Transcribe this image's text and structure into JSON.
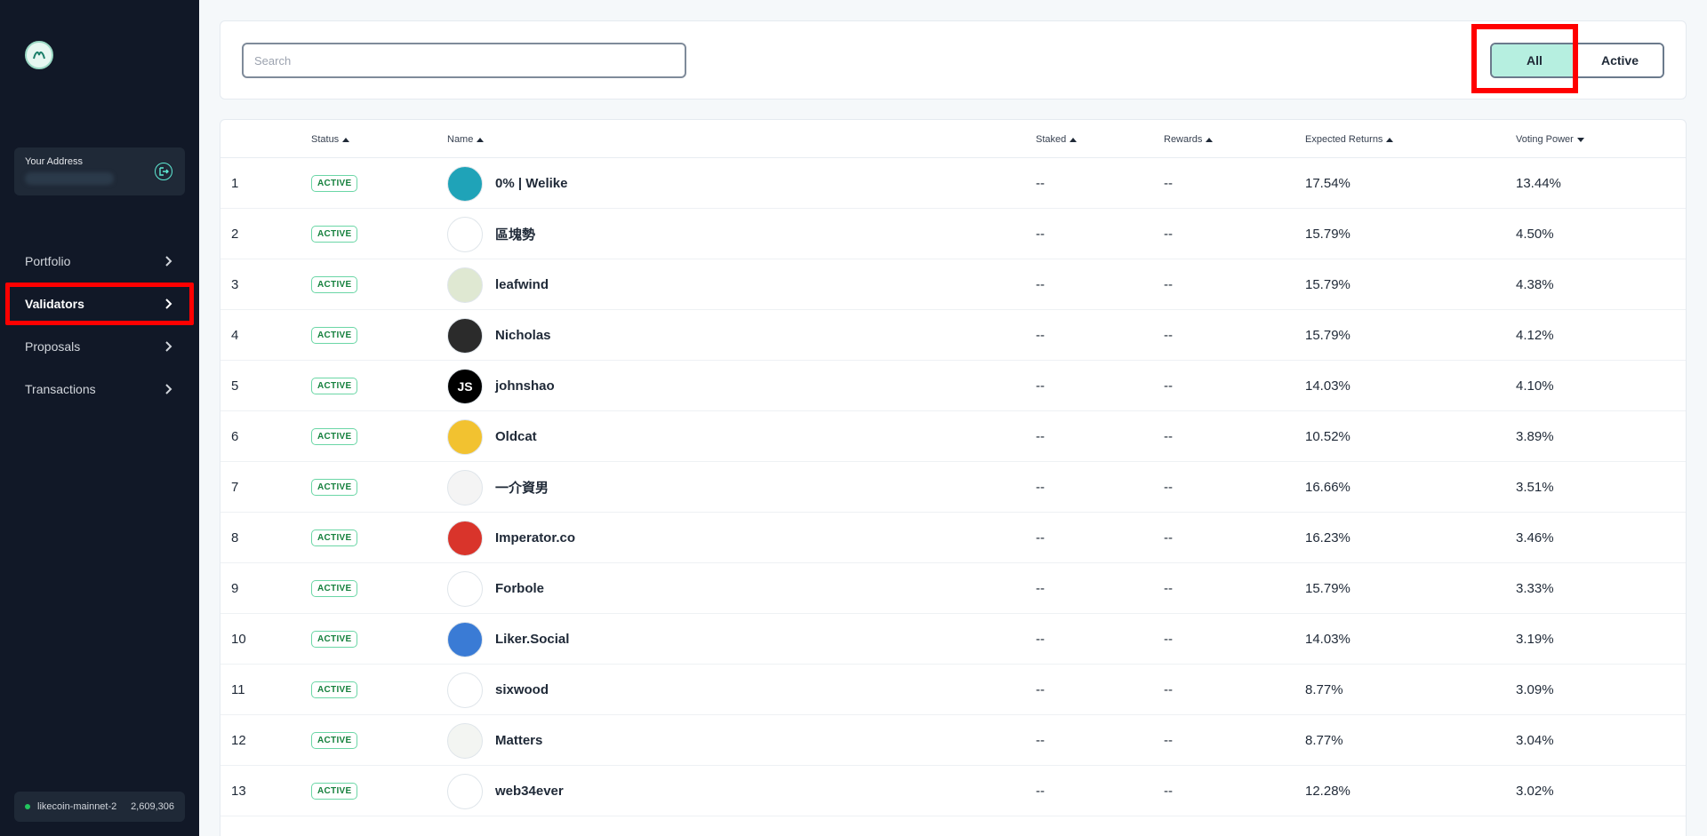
{
  "sidebar": {
    "address_label": "Your Address",
    "nav": [
      {
        "label": "Portfolio"
      },
      {
        "label": "Validators"
      },
      {
        "label": "Proposals"
      },
      {
        "label": "Transactions"
      }
    ],
    "network": {
      "chain": "likecoin-mainnet-2",
      "block": "2,609,306"
    }
  },
  "toolbar": {
    "search_placeholder": "Search",
    "filters": {
      "all": "All",
      "active": "Active"
    },
    "selected_filter": "All"
  },
  "table": {
    "headers": {
      "status": "Status",
      "name": "Name",
      "staked": "Staked",
      "rewards": "Rewards",
      "expected_returns": "Expected Returns",
      "voting_power": "Voting Power"
    },
    "rows": [
      {
        "rank": "1",
        "status": "ACTIVE",
        "name": "0% | Welike",
        "staked": "--",
        "rewards": "--",
        "expected_returns": "17.54%",
        "voting_power": "13.44%",
        "avatar_initials": "",
        "avatar_color": "#1fa3b8"
      },
      {
        "rank": "2",
        "status": "ACTIVE",
        "name": "區塊勢",
        "staked": "--",
        "rewards": "--",
        "expected_returns": "15.79%",
        "voting_power": "4.50%",
        "avatar_initials": "",
        "avatar_color": "#ffffff"
      },
      {
        "rank": "3",
        "status": "ACTIVE",
        "name": "leafwind",
        "staked": "--",
        "rewards": "--",
        "expected_returns": "15.79%",
        "voting_power": "4.38%",
        "avatar_initials": "",
        "avatar_color": "#dfe8d2"
      },
      {
        "rank": "4",
        "status": "ACTIVE",
        "name": "Nicholas",
        "staked": "--",
        "rewards": "--",
        "expected_returns": "15.79%",
        "voting_power": "4.12%",
        "avatar_initials": "",
        "avatar_color": "#2b2b2b"
      },
      {
        "rank": "5",
        "status": "ACTIVE",
        "name": "johnshao",
        "staked": "--",
        "rewards": "--",
        "expected_returns": "14.03%",
        "voting_power": "4.10%",
        "avatar_initials": "JS",
        "avatar_color": "#000000"
      },
      {
        "rank": "6",
        "status": "ACTIVE",
        "name": "Oldcat",
        "staked": "--",
        "rewards": "--",
        "expected_returns": "10.52%",
        "voting_power": "3.89%",
        "avatar_initials": "",
        "avatar_color": "#f2c230"
      },
      {
        "rank": "7",
        "status": "ACTIVE",
        "name": "一介資男",
        "staked": "--",
        "rewards": "--",
        "expected_returns": "16.66%",
        "voting_power": "3.51%",
        "avatar_initials": "",
        "avatar_color": "#f4f4f4"
      },
      {
        "rank": "8",
        "status": "ACTIVE",
        "name": "Imperator.co",
        "staked": "--",
        "rewards": "--",
        "expected_returns": "16.23%",
        "voting_power": "3.46%",
        "avatar_initials": "",
        "avatar_color": "#d9342b"
      },
      {
        "rank": "9",
        "status": "ACTIVE",
        "name": "Forbole",
        "staked": "--",
        "rewards": "--",
        "expected_returns": "15.79%",
        "voting_power": "3.33%",
        "avatar_initials": "",
        "avatar_color": "#ffffff"
      },
      {
        "rank": "10",
        "status": "ACTIVE",
        "name": "Liker.Social",
        "staked": "--",
        "rewards": "--",
        "expected_returns": "14.03%",
        "voting_power": "3.19%",
        "avatar_initials": "",
        "avatar_color": "#3a7bd5"
      },
      {
        "rank": "11",
        "status": "ACTIVE",
        "name": "sixwood",
        "staked": "--",
        "rewards": "--",
        "expected_returns": "8.77%",
        "voting_power": "3.09%",
        "avatar_initials": "",
        "avatar_color": "#ffffff"
      },
      {
        "rank": "12",
        "status": "ACTIVE",
        "name": "Matters",
        "staked": "--",
        "rewards": "--",
        "expected_returns": "8.77%",
        "voting_power": "3.04%",
        "avatar_initials": "",
        "avatar_color": "#f3f5f2"
      },
      {
        "rank": "13",
        "status": "ACTIVE",
        "name": "web34ever",
        "staked": "--",
        "rewards": "--",
        "expected_returns": "12.28%",
        "voting_power": "3.02%",
        "avatar_initials": "",
        "avatar_color": "#ffffff"
      }
    ]
  },
  "colors": {
    "sidebar_bg": "#111827",
    "accent_mint": "#b6efe0",
    "active_badge": "#6bd6a6",
    "highlight_red": "#ff0000"
  }
}
